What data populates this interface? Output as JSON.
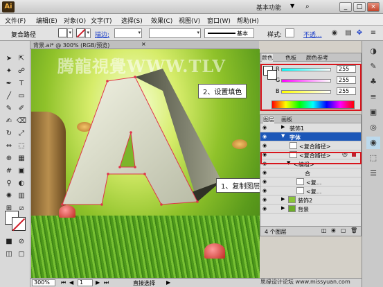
{
  "title_bar": {
    "app_logo": "Ai",
    "workspace": "基本功能",
    "icons": [
      "workspace-caret-icon",
      "search-icon",
      "minimize-icon",
      "maximize-icon",
      "close-icon"
    ]
  },
  "menu": {
    "items": [
      "文件(F)",
      "编辑(E)",
      "对象(O)",
      "文字(T)",
      "选择(S)",
      "效果(C)",
      "视图(V)",
      "窗口(W)",
      "帮助(H)"
    ]
  },
  "control_bar": {
    "object_type": "复合路径",
    "stroke_label": "描边:",
    "profile_label": "基本",
    "style_label": "样式:",
    "opacity_link": "不透..."
  },
  "document": {
    "tab_title": "背景.ai* @ 300% (RGB/预览)",
    "close_glyph": "×"
  },
  "canvas": {
    "watermark": "腾龍視覺WWW.TLV",
    "letter": "A",
    "colors": {
      "letter_light": "#eef0dc",
      "letter_dark": "#3b3d32",
      "selection": "#e0344a"
    }
  },
  "annotations": {
    "step1": "1、复制图层调整图层顺",
    "step2": "2、设置填色"
  },
  "color_panel": {
    "tabs": [
      "颜色",
      "色板",
      "颜色参考"
    ],
    "channels": [
      {
        "label": "R",
        "value": "255",
        "color": "#e02020"
      },
      {
        "label": "G",
        "value": "255",
        "color": "#20c020"
      },
      {
        "label": "B",
        "value": "255",
        "color": "#2020e0"
      }
    ]
  },
  "layers_panel": {
    "tabs": [
      "图层",
      "画板"
    ],
    "rows": [
      {
        "name": "装饰1",
        "selected": false
      },
      {
        "name": "字体",
        "selected": true
      },
      {
        "name": "<复合路径>",
        "selected": false
      },
      {
        "name": "<复合路径>",
        "selected": false
      },
      {
        "name": "<编组>",
        "selected": false
      },
      {
        "name": "合",
        "selected": false
      },
      {
        "name": "<复...",
        "selected": false
      },
      {
        "name": "<复...",
        "selected": false
      },
      {
        "name": "装饰2",
        "selected": false
      },
      {
        "name": "背景",
        "selected": false
      }
    ],
    "footer_count": "4 个图层"
  },
  "status_bar": {
    "zoom": "300%",
    "page": "1",
    "mode": "直接选择",
    "credit": "思缘设计论坛 www.missyuan.com"
  }
}
